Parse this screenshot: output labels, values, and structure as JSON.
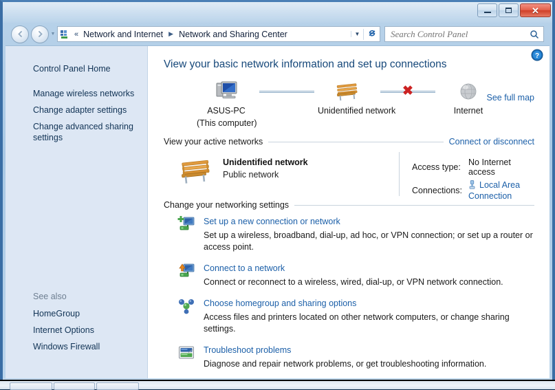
{
  "window": {
    "controls": {
      "minimize": "Minimize",
      "maximize": "Maximize",
      "close": "✕"
    }
  },
  "navbar": {
    "back": "◀",
    "forward": "▶",
    "recent_pages": "▼",
    "double_chevron": "«",
    "breadcrumbs": [
      {
        "label": "Network and Internet"
      },
      {
        "label": "Network and Sharing Center"
      }
    ],
    "breadcrumb_separator": "▶",
    "address_dropdown": "▼",
    "refresh": "↻",
    "search": {
      "value": "",
      "placeholder": "Search Control Panel"
    }
  },
  "sidebar": {
    "home_link": "Control Panel Home",
    "items": [
      {
        "label": "Manage wireless networks"
      },
      {
        "label": "Change adapter settings"
      },
      {
        "label": "Change advanced sharing settings"
      }
    ],
    "see_also_label": "See also",
    "see_also": [
      {
        "label": "HomeGroup"
      },
      {
        "label": "Internet Options"
      },
      {
        "label": "Windows Firewall"
      }
    ]
  },
  "main": {
    "page_title": "View your basic network information and set up connections",
    "see_full_map": "See full map",
    "network_map": {
      "nodes": [
        {
          "name": "computer",
          "label_line1": "ASUS-PC",
          "label_line2": "(This computer)"
        },
        {
          "name": "network",
          "label_line1": "Unidentified network",
          "label_line2": ""
        },
        {
          "name": "internet",
          "label_line1": "Internet",
          "label_line2": ""
        }
      ],
      "links": [
        {
          "state": "connected",
          "mark": ""
        },
        {
          "state": "broken",
          "mark": "✖"
        }
      ]
    },
    "active_networks": {
      "heading": "View your active networks",
      "action": "Connect or disconnect",
      "network_name": "Unidentified network",
      "network_type": "Public network",
      "access_type_label": "Access type:",
      "access_type_value": "No Internet access",
      "connections_label": "Connections:",
      "connections_value": "Local Area Connection"
    },
    "networking_settings": {
      "heading": "Change your networking settings",
      "tasks": [
        {
          "icon": "new-connection-icon",
          "link": "Set up a new connection or network",
          "desc": "Set up a wireless, broadband, dial-up, ad hoc, or VPN connection; or set up a router or access point."
        },
        {
          "icon": "connect-network-icon",
          "link": "Connect to a network",
          "desc": "Connect or reconnect to a wireless, wired, dial-up, or VPN network connection."
        },
        {
          "icon": "homegroup-icon",
          "link": "Choose homegroup and sharing options",
          "desc": "Access files and printers located on other network computers, or change sharing settings."
        },
        {
          "icon": "troubleshoot-icon",
          "link": "Troubleshoot problems",
          "desc": "Diagnose and repair network problems, or get troubleshooting information."
        }
      ]
    },
    "help_icon": "?"
  },
  "colors": {
    "link": "#1b5fa8",
    "title": "#16487a",
    "sidebar_bg": "#dde7f4",
    "frame": "#3a6ea5",
    "error": "#cc2222"
  }
}
